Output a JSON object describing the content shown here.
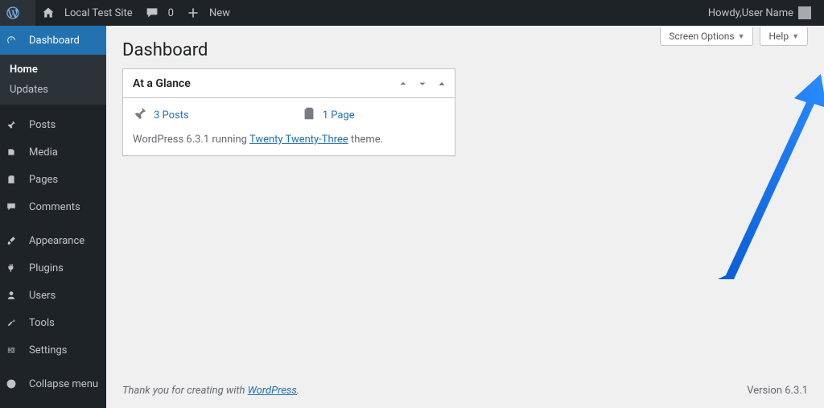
{
  "adminbar": {
    "site_name": "Local Test Site",
    "comments_count": "0",
    "new_label": "New",
    "howdy_prefix": "Howdy, ",
    "user_name": "User Name"
  },
  "sidebar": {
    "items": [
      {
        "label": "Dashboard",
        "icon": "dashboard"
      },
      {
        "label": "Posts",
        "icon": "pin"
      },
      {
        "label": "Media",
        "icon": "media"
      },
      {
        "label": "Pages",
        "icon": "pages"
      },
      {
        "label": "Comments",
        "icon": "comment"
      },
      {
        "label": "Appearance",
        "icon": "brush"
      },
      {
        "label": "Plugins",
        "icon": "plug"
      },
      {
        "label": "Users",
        "icon": "user"
      },
      {
        "label": "Tools",
        "icon": "wrench"
      },
      {
        "label": "Settings",
        "icon": "sliders"
      },
      {
        "label": "Collapse menu",
        "icon": "collapse"
      }
    ],
    "submenu": {
      "home": "Home",
      "updates": "Updates"
    }
  },
  "screen_options_label": "Screen Options",
  "help_label": "Help",
  "page_title": "Dashboard",
  "at_a_glance": {
    "title": "At a Glance",
    "posts_count": "3 Posts",
    "pages_count": "1 Page",
    "wp_running_prefix": "WordPress 6.3.1 running ",
    "theme_name": "Twenty Twenty-Three",
    "theme_suffix": " theme."
  },
  "footer": {
    "thanks_prefix": "Thank you for creating with ",
    "wordpress_label": "WordPress",
    "version_label": "Version 6.3.1"
  }
}
